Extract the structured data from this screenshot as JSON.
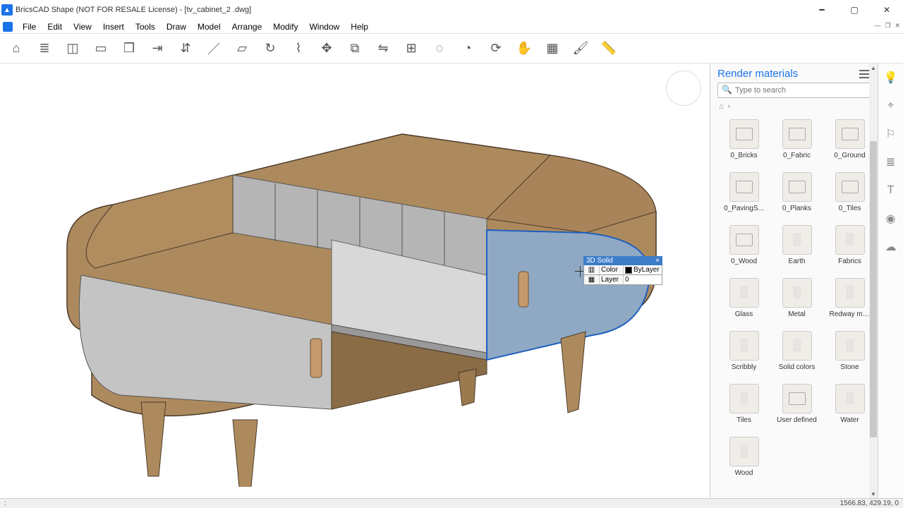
{
  "title": "BricsCAD Shape (NOT FOR RESALE License) - [tv_cabinet_2 .dwg]",
  "menu": [
    "File",
    "Edit",
    "View",
    "Insert",
    "Tools",
    "Draw",
    "Model",
    "Arrange",
    "Modify",
    "Window",
    "Help"
  ],
  "toolbar_icons": [
    "home",
    "layers",
    "stack",
    "box",
    "cube",
    "extrude",
    "pushpull",
    "line",
    "rect",
    "sweep",
    "loft",
    "move",
    "copy",
    "mirror",
    "array",
    "connect",
    "offset",
    "rotate",
    "pan",
    "select",
    "paint",
    "measure"
  ],
  "panel": {
    "title": "Render materials",
    "search_placeholder": "Type to search",
    "materials": [
      {
        "label": "0_Bricks",
        "type": "folder"
      },
      {
        "label": "0_Fabric",
        "type": "folder"
      },
      {
        "label": "0_Ground",
        "type": "folder"
      },
      {
        "label": "0_PavingS...",
        "type": "folder"
      },
      {
        "label": "0_Planks",
        "type": "folder"
      },
      {
        "label": "0_Tiles",
        "type": "folder"
      },
      {
        "label": "0_Wood",
        "type": "folder"
      },
      {
        "label": "Earth",
        "type": "tex"
      },
      {
        "label": "Fabrics",
        "type": "tex"
      },
      {
        "label": "Glass",
        "type": "tex"
      },
      {
        "label": "Metal",
        "type": "tex"
      },
      {
        "label": "Redway materials",
        "type": "tex"
      },
      {
        "label": "Scribbly",
        "type": "tex"
      },
      {
        "label": "Solid colors",
        "type": "tex"
      },
      {
        "label": "Stone",
        "type": "tex"
      },
      {
        "label": "Tiles",
        "type": "tex"
      },
      {
        "label": "User defined",
        "type": "folder"
      },
      {
        "label": "Water",
        "type": "tex"
      },
      {
        "label": "Wood",
        "type": "tex"
      }
    ]
  },
  "popup": {
    "header": "3D Solid",
    "color_label": "Color",
    "color_value": "ByLayer",
    "layer_label": "Layer",
    "layer_value": "0"
  },
  "status": {
    "left": ":",
    "coords": "1566.83, 429.19, 0"
  }
}
